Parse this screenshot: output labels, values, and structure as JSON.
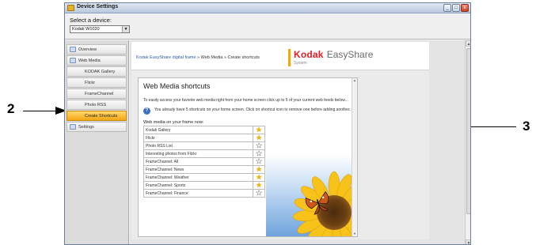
{
  "window": {
    "title": "Device Settings",
    "controls": [
      "_",
      "□",
      "x"
    ]
  },
  "device": {
    "label": "Select a device:",
    "selected": "Kodak W1020"
  },
  "sidebar": {
    "items": [
      {
        "label": "Overview"
      },
      {
        "label": "Web Media"
      },
      {
        "label": "KODAK Gallery"
      },
      {
        "label": "Flickr"
      },
      {
        "label": "FrameChannel"
      },
      {
        "label": "Photo RSS"
      },
      {
        "label": "Create Shortcuts"
      },
      {
        "label": "Settings"
      }
    ]
  },
  "header": {
    "breadcrumb_link": "Kodak EasyShare digital frame",
    "breadcrumb_rest": "» Web Media » Create shortcuts",
    "brand": "Kodak",
    "product": "EasyShare",
    "product_sub": "System"
  },
  "panel": {
    "title": "Web Media shortcuts",
    "intro": "To easily access your favorite web media right from your home screen click up to 5 of your current web feeds below...",
    "info": "You already have 5 shortcuts on your home screen. Click on shortcut icon to remove one before adding another.",
    "list_heading": "Web media on your frame now:",
    "shortcuts": [
      {
        "label": "Kodak Gallery",
        "starred": true
      },
      {
        "label": "Flickr",
        "starred": true
      },
      {
        "label": "Photo RSS List",
        "starred": false
      },
      {
        "label": "Interesting photos from Flickr",
        "starred": false
      },
      {
        "label": "FrameChannel: All",
        "starred": false
      },
      {
        "label": "FrameChannel: News",
        "starred": true
      },
      {
        "label": "FrameChannel: Weather",
        "starred": true
      },
      {
        "label": "FrameChannel: Sports",
        "starred": true
      },
      {
        "label": "FrameChannel: Finance",
        "starred": false
      }
    ]
  },
  "callouts": {
    "left": "2",
    "right": "3"
  },
  "colors": {
    "accent": "#f4a615",
    "brand_red": "#e31b23",
    "star_on": "#f4b400"
  }
}
